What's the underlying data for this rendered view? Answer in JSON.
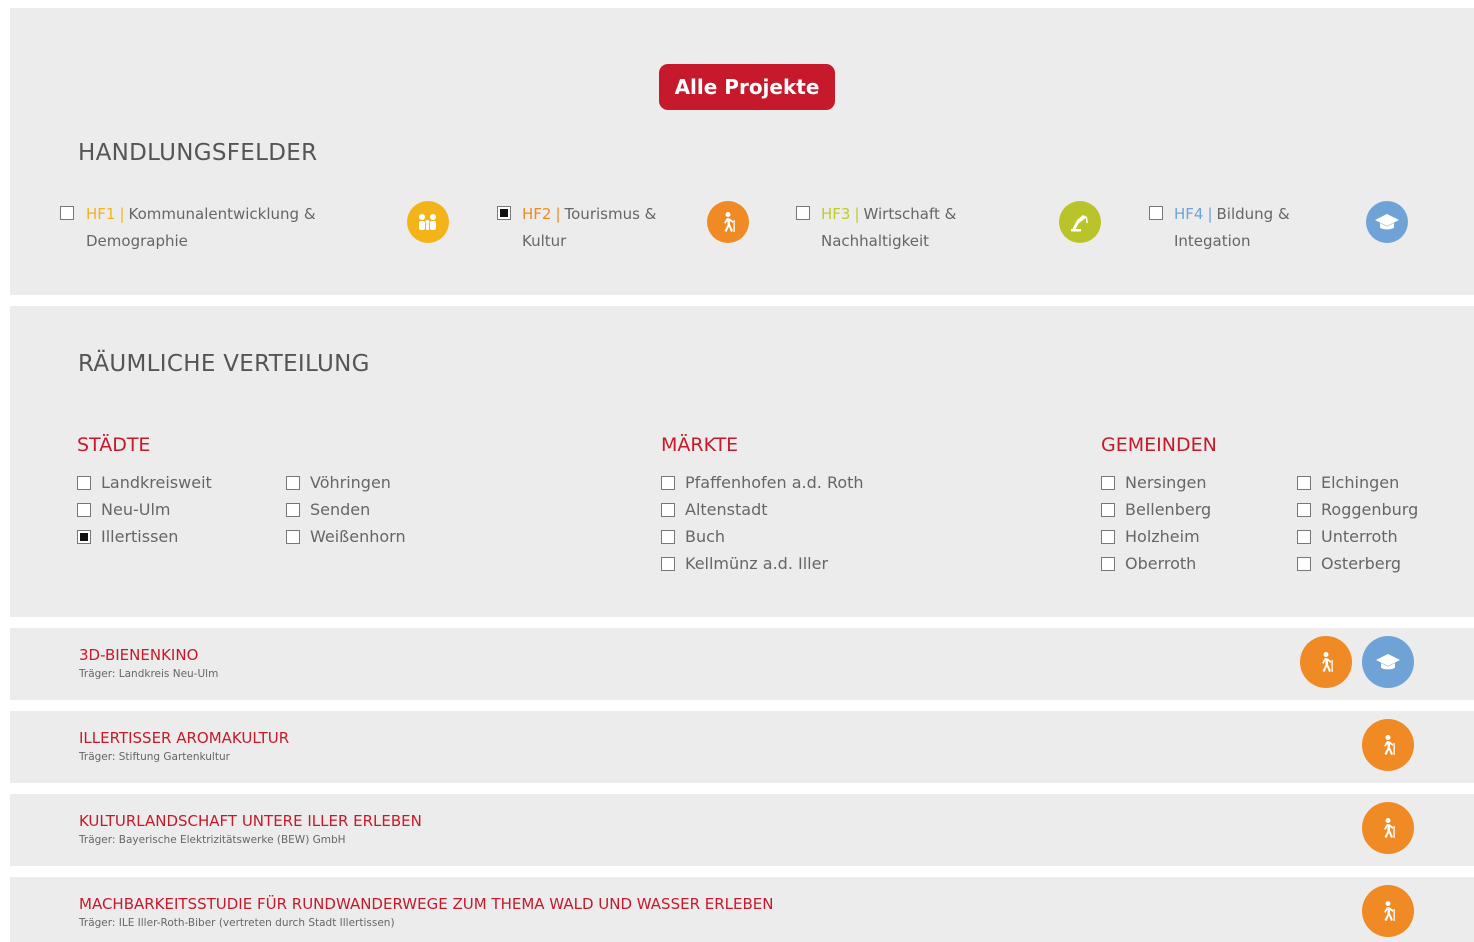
{
  "header": {
    "all_projects_label": "Alle Projekte"
  },
  "handlungsfelder": {
    "title": "HANDLUNGSFELDER",
    "items": [
      {
        "code": "HF1",
        "sep": "|",
        "line1": "Kommunalentwicklung &",
        "line2": "Demographie",
        "checked": false,
        "code_color": "#f2b418",
        "icon": "family-icon",
        "icon_color": "#f2b418"
      },
      {
        "code": "HF2",
        "sep": "|",
        "line1": "Tourismus &",
        "line2": "Kultur",
        "checked": true,
        "code_color": "#f08a24",
        "icon": "hiker-icon",
        "icon_color": "#f08a24"
      },
      {
        "code": "HF3",
        "sep": "|",
        "line1": "Wirtschaft &",
        "line2": "Nachhaltigkeit",
        "checked": false,
        "code_color": "#c2ca2b",
        "icon": "crane-icon",
        "icon_color": "#b9c42b"
      },
      {
        "code": "HF4",
        "sep": "|",
        "line1": "Bildung &",
        "line2": "Integation",
        "checked": false,
        "code_color": "#6fa2d6",
        "icon": "graduation-cap-icon",
        "icon_color": "#6fa2d6"
      }
    ]
  },
  "verteilung": {
    "title": "RÄUMLICHE VERTEILUNG",
    "staedte": {
      "title": "STÄDTE",
      "col1": [
        {
          "label": "Landkreisweit",
          "checked": false
        },
        {
          "label": "Neu-Ulm",
          "checked": false
        },
        {
          "label": "Illertissen",
          "checked": true
        }
      ],
      "col2": [
        {
          "label": "Vöhringen",
          "checked": false
        },
        {
          "label": "Senden",
          "checked": false
        },
        {
          "label": "Weißenhorn",
          "checked": false
        }
      ]
    },
    "maerkte": {
      "title": "MÄRKTE",
      "col1": [
        {
          "label": "Pfaffenhofen a.d. Roth",
          "checked": false
        },
        {
          "label": "Altenstadt",
          "checked": false
        },
        {
          "label": "Buch",
          "checked": false
        },
        {
          "label": "Kellmünz a.d. Iller",
          "checked": false
        }
      ]
    },
    "gemeinden": {
      "title": "GEMEINDEN",
      "col1": [
        {
          "label": "Nersingen",
          "checked": false
        },
        {
          "label": "Bellenberg",
          "checked": false
        },
        {
          "label": "Holzheim",
          "checked": false
        },
        {
          "label": "Oberroth",
          "checked": false
        }
      ],
      "col2": [
        {
          "label": "Elchingen",
          "checked": false
        },
        {
          "label": "Roggenburg",
          "checked": false
        },
        {
          "label": "Unterroth",
          "checked": false
        },
        {
          "label": "Osterberg",
          "checked": false
        }
      ]
    }
  },
  "projects": [
    {
      "title": "3D-BIENENKINO",
      "traeger": "Träger: Landkreis Neu-Ulm",
      "icons": [
        "hiker-icon",
        "graduation-cap-icon"
      ]
    },
    {
      "title": "ILLERTISSER AROMAKULTUR",
      "traeger": "Träger: Stiftung Gartenkultur",
      "icons": [
        "hiker-icon"
      ]
    },
    {
      "title": "KULTURLANDSCHAFT UNTERE ILLER ERLEBEN",
      "traeger": "Träger: Bayerische Elektrizitätswerke (BEW) GmbH",
      "icons": [
        "hiker-icon"
      ]
    },
    {
      "title": "MACHBARKEITSSTUDIE FÜR RUNDWANDERWEGE ZUM THEMA WALD UND WASSER ERLEBEN",
      "traeger": "Träger: ILE Iller-Roth-Biber (vertreten durch Stadt Illertissen)",
      "icons": [
        "hiker-icon"
      ]
    }
  ],
  "colors": {
    "accent": "#c6192b",
    "panel": "#ececec",
    "orange": "#f08a24",
    "blue": "#6fa2d6"
  }
}
